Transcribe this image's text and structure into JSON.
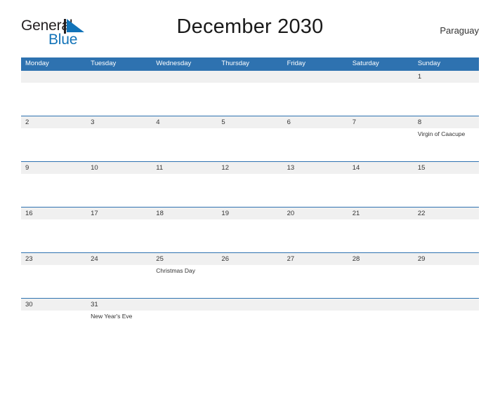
{
  "logo": {
    "word_one": "General",
    "word_two": "Blue",
    "flag_color": "#1273b8",
    "text_color": "#231f20"
  },
  "header": {
    "title": "December 2030",
    "country": "Paraguay"
  },
  "theme": {
    "header_blue": "#2e72b0",
    "band_gray": "#f0f0f0",
    "text": "#333333",
    "page_background": "#ffffff"
  },
  "calendar": {
    "weekdays": [
      "Monday",
      "Tuesday",
      "Wednesday",
      "Thursday",
      "Friday",
      "Saturday",
      "Sunday"
    ],
    "weeks": [
      {
        "days": [
          {
            "date": "",
            "event": ""
          },
          {
            "date": "",
            "event": ""
          },
          {
            "date": "",
            "event": ""
          },
          {
            "date": "",
            "event": ""
          },
          {
            "date": "",
            "event": ""
          },
          {
            "date": "",
            "event": ""
          },
          {
            "date": "1",
            "event": ""
          }
        ]
      },
      {
        "days": [
          {
            "date": "2",
            "event": ""
          },
          {
            "date": "3",
            "event": ""
          },
          {
            "date": "4",
            "event": ""
          },
          {
            "date": "5",
            "event": ""
          },
          {
            "date": "6",
            "event": ""
          },
          {
            "date": "7",
            "event": ""
          },
          {
            "date": "8",
            "event": "Virgin of Caacupe"
          }
        ]
      },
      {
        "days": [
          {
            "date": "9",
            "event": ""
          },
          {
            "date": "10",
            "event": ""
          },
          {
            "date": "11",
            "event": ""
          },
          {
            "date": "12",
            "event": ""
          },
          {
            "date": "13",
            "event": ""
          },
          {
            "date": "14",
            "event": ""
          },
          {
            "date": "15",
            "event": ""
          }
        ]
      },
      {
        "days": [
          {
            "date": "16",
            "event": ""
          },
          {
            "date": "17",
            "event": ""
          },
          {
            "date": "18",
            "event": ""
          },
          {
            "date": "19",
            "event": ""
          },
          {
            "date": "20",
            "event": ""
          },
          {
            "date": "21",
            "event": ""
          },
          {
            "date": "22",
            "event": ""
          }
        ]
      },
      {
        "days": [
          {
            "date": "23",
            "event": ""
          },
          {
            "date": "24",
            "event": ""
          },
          {
            "date": "25",
            "event": "Christmas Day"
          },
          {
            "date": "26",
            "event": ""
          },
          {
            "date": "27",
            "event": ""
          },
          {
            "date": "28",
            "event": ""
          },
          {
            "date": "29",
            "event": ""
          }
        ]
      },
      {
        "days": [
          {
            "date": "30",
            "event": ""
          },
          {
            "date": "31",
            "event": "New Year's Eve"
          },
          {
            "date": "",
            "event": ""
          },
          {
            "date": "",
            "event": ""
          },
          {
            "date": "",
            "event": ""
          },
          {
            "date": "",
            "event": ""
          },
          {
            "date": "",
            "event": ""
          }
        ]
      }
    ]
  }
}
